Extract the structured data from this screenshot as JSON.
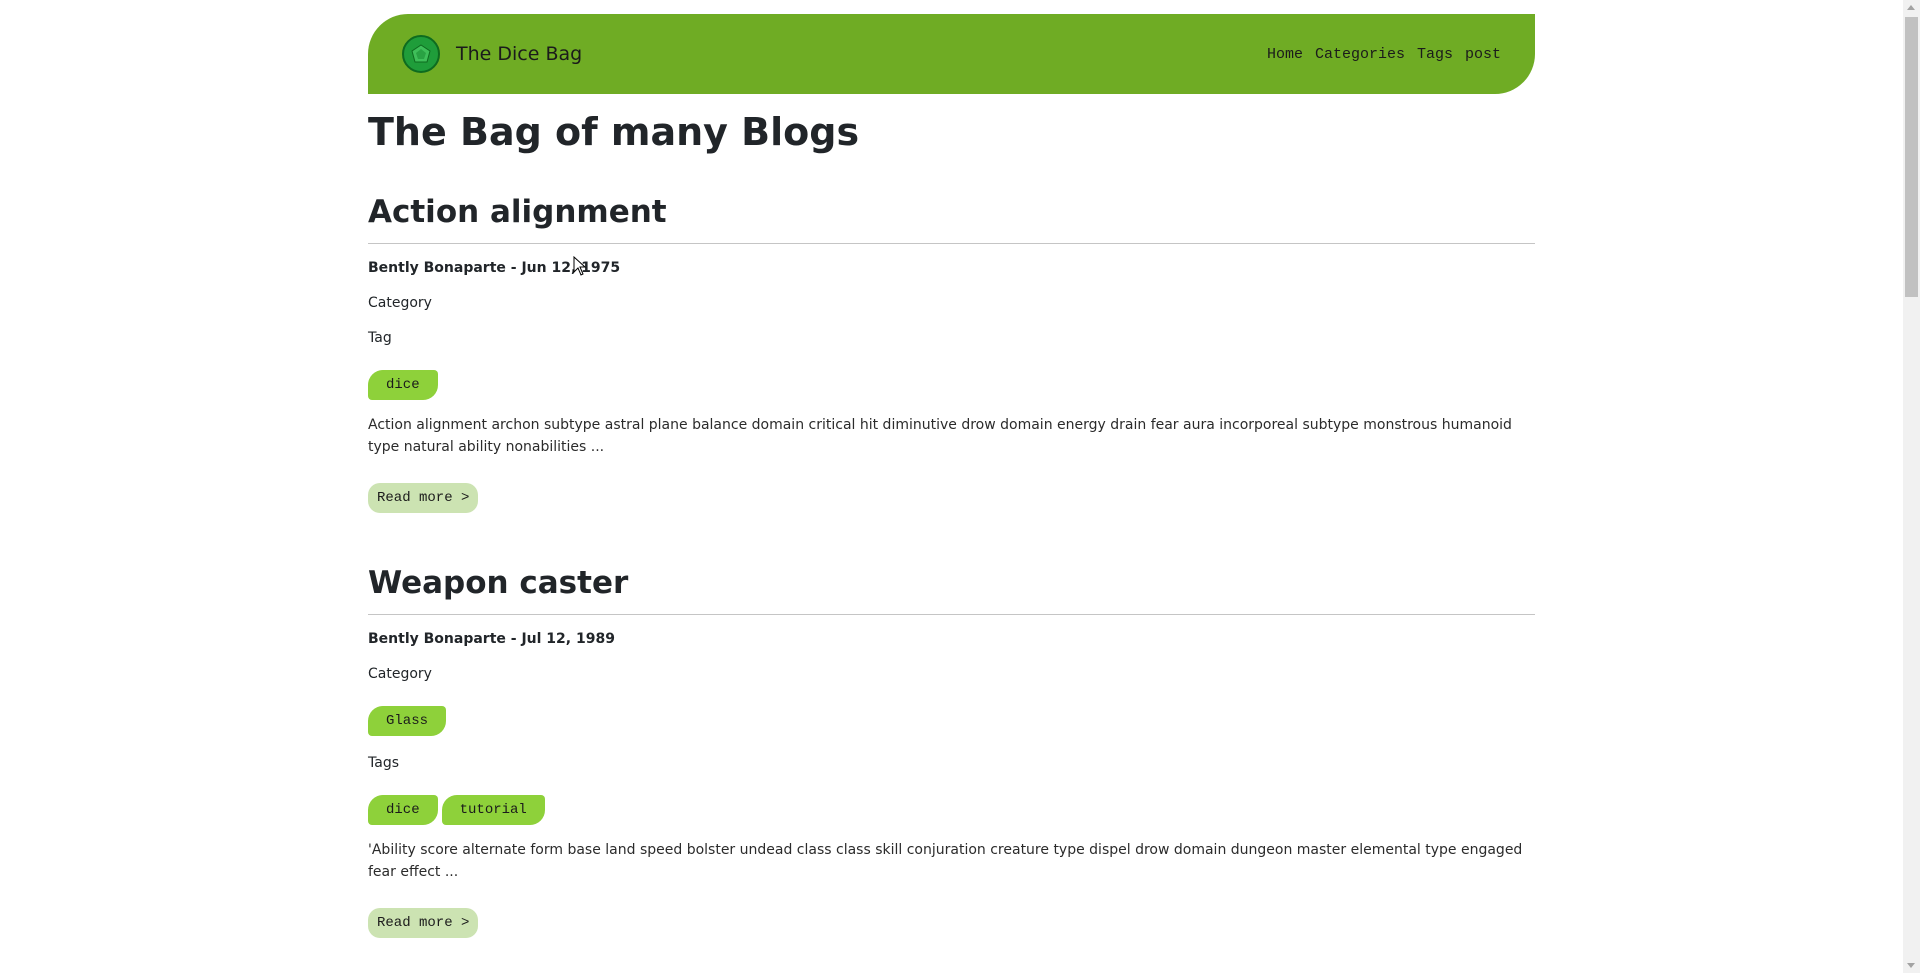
{
  "colors": {
    "navbar": "#6fac24",
    "pill": "#8ed13a",
    "read_more": "#cce3b2",
    "logo": "#1f9d3a"
  },
  "navbar": {
    "logo_icon": "dice-logo-icon",
    "brand": "The Dice Bag",
    "links": [
      "Home",
      "Categories",
      "Tags",
      "post"
    ]
  },
  "page_title": "The Bag of many Blogs",
  "posts": [
    {
      "title": "Action alignment",
      "meta": "Bently Bonaparte - Jun 12, 1975",
      "category_label": "Category",
      "categories": [],
      "tag_label": "Tag",
      "tags": [
        "dice"
      ],
      "excerpt": "Action alignment archon subtype astral plane balance domain critical hit diminutive drow domain energy drain fear aura incorporeal subtype monstrous humanoid type natural ability nonabilities ...",
      "read_more": "Read more >"
    },
    {
      "title": "Weapon caster",
      "meta": "Bently Bonaparte - Jul 12, 1989",
      "category_label": "Category",
      "categories": [
        "Glass"
      ],
      "tag_label": "Tags",
      "tags": [
        "dice",
        "tutorial"
      ],
      "excerpt": "'Ability score alternate form base land speed bolster undead class class skill conjuration creature type dispel drow domain dungeon master elemental type engaged fear effect ...",
      "read_more": "Read more >"
    }
  ]
}
